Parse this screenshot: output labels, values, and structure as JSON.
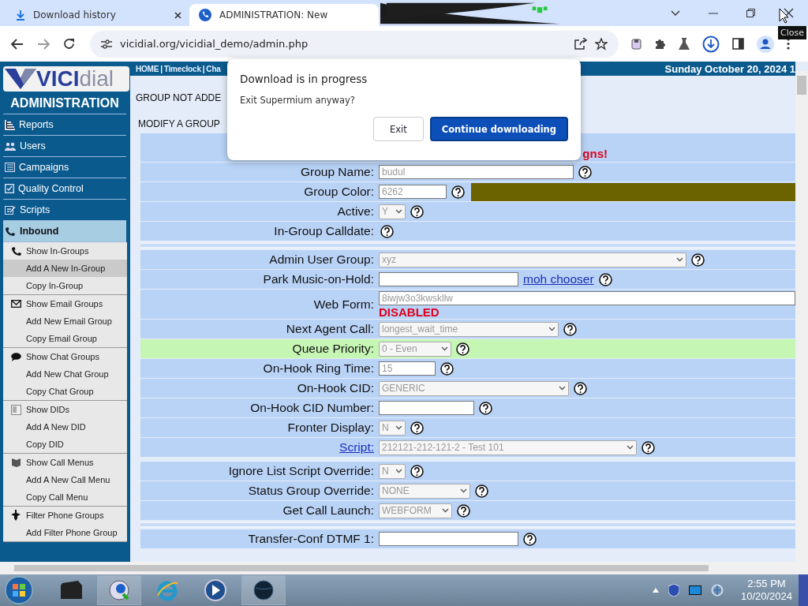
{
  "browser": {
    "tabs": [
      {
        "title": "Download history",
        "selected": false
      },
      {
        "title": "ADMINISTRATION: New",
        "selected": true
      }
    ],
    "address": "vicidial.org/vicidial_demo/admin.php",
    "tooltip": "Close"
  },
  "sidebar": {
    "logo": {
      "strong": "VICI",
      "light": "dial"
    },
    "title": "ADMINISTRATION",
    "items": [
      {
        "label": "Reports",
        "selected": false
      },
      {
        "label": "Users",
        "selected": false
      },
      {
        "label": "Campaigns",
        "selected": false
      },
      {
        "label": "Quality Control",
        "selected": false
      },
      {
        "label": "Scripts",
        "selected": false
      },
      {
        "label": "Inbound",
        "selected": true
      }
    ],
    "submenu": [
      [
        {
          "label": "Show In-Groups",
          "selected": false
        },
        {
          "label": "Add A New In-Group",
          "selected": true
        },
        {
          "label": "Copy In-Group",
          "selected": false
        }
      ],
      [
        {
          "label": "Show Email Groups",
          "selected": false
        },
        {
          "label": "Add New Email Group",
          "selected": false
        },
        {
          "label": "Copy Email Group",
          "selected": false
        }
      ],
      [
        {
          "label": "Show Chat Groups",
          "selected": false
        },
        {
          "label": "Add New Chat Group",
          "selected": false
        },
        {
          "label": "Copy Chat Group",
          "selected": false
        }
      ],
      [
        {
          "label": "Show DIDs",
          "selected": false
        },
        {
          "label": "Add A New DID",
          "selected": false
        },
        {
          "label": "Copy DID",
          "selected": false
        }
      ],
      [
        {
          "label": "Show Call Menus",
          "selected": false
        },
        {
          "label": "Add A New Call Menu",
          "selected": false
        },
        {
          "label": "Copy Call Menu",
          "selected": false
        }
      ],
      [
        {
          "label": "Filter Phone Groups",
          "selected": false
        },
        {
          "label": "Add Filter Phone Group",
          "selected": false
        }
      ]
    ]
  },
  "header": {
    "links": [
      "HOME",
      "Timeclock",
      "Cha"
    ],
    "separator": "|",
    "date": "Sunday October 20, 2024 1"
  },
  "notice": "GROUP NOT ADDE",
  "section_title": "MODIFY A GROUP",
  "warning": "gns!",
  "form": [
    {
      "kind": "input",
      "label": "Group Name:",
      "value": "budul"
    },
    {
      "kind": "input",
      "label": "Group Color:",
      "value": "6262",
      "color": "#6b6200"
    },
    {
      "kind": "select",
      "label": "Active:",
      "value": "Y"
    },
    {
      "kind": "help",
      "label": "In-Group Calldate:"
    },
    {
      "kind": "separator"
    },
    {
      "kind": "select",
      "label": "Admin User Group:",
      "value": "xyz"
    },
    {
      "kind": "input",
      "label": "Park Music-on-Hold:",
      "link": "moh chooser"
    },
    {
      "kind": "input",
      "label": "Web Form:",
      "value": "8iwjw3o3kwskllw",
      "note": "DISABLED"
    },
    {
      "kind": "select",
      "label": "Next Agent Call:",
      "value": "longest_wait_time"
    },
    {
      "kind": "select",
      "label": "Queue Priority:",
      "value": "0 - Even",
      "highlighted": true
    },
    {
      "kind": "input",
      "label": "On-Hook Ring Time:",
      "value": "15"
    },
    {
      "kind": "select",
      "label": "On-Hook CID:",
      "value": "GENERIC"
    },
    {
      "kind": "input",
      "label": "On-Hook CID Number:"
    },
    {
      "kind": "select",
      "label": "Fronter Display:",
      "value": "N"
    },
    {
      "kind": "select",
      "label": "Script:",
      "value": "212121-212-121-2 - Test 101",
      "label_link": true
    },
    {
      "kind": "gap"
    },
    {
      "kind": "select",
      "label": "Ignore List Script Override:",
      "value": "N"
    },
    {
      "kind": "select",
      "label": "Status Group Override:",
      "value": "NONE"
    },
    {
      "kind": "select",
      "label": "Get Call Launch:",
      "value": "WEBFORM"
    },
    {
      "kind": "separator"
    },
    {
      "kind": "input",
      "label": "Transfer-Conf DTMF 1:"
    }
  ],
  "dialog": {
    "title": "Download is in progress",
    "message": "Exit Supermium anyway?",
    "buttons": [
      {
        "label": "Exit",
        "primary": false
      },
      {
        "label": "Continue downloading",
        "primary": true
      }
    ]
  },
  "taskbar": {
    "time": "2:55 PM",
    "date": "10/20/2024"
  }
}
